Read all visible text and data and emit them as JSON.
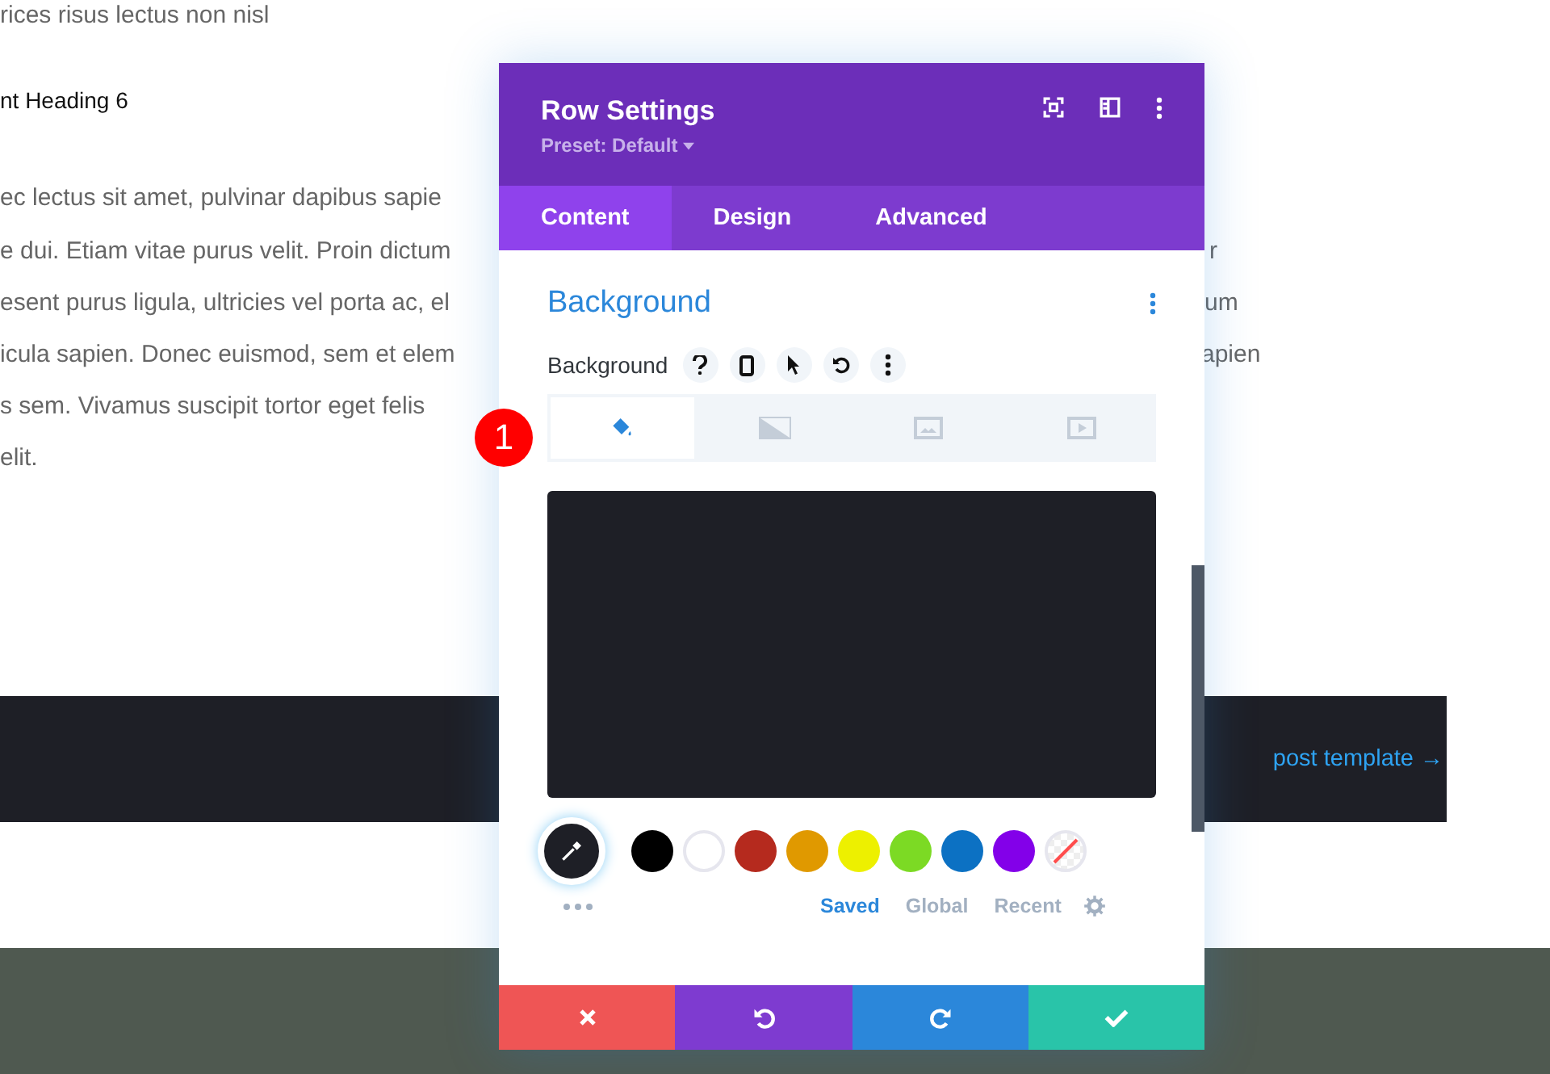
{
  "page": {
    "lines": [
      {
        "kind": "body",
        "left": "rices risus lectus non nisl"
      },
      {
        "kind": "heading",
        "left": "nt Heading 6"
      },
      {
        "kind": "body",
        "left": "ec lectus sit amet, pulvinar dapibus sapie"
      },
      {
        "kind": "body",
        "left": "e dui. Etiam vitae purus velit. Proin dictum",
        "right": "r"
      },
      {
        "kind": "body",
        "left": "esent purus ligula, ultricies vel porta ac, el",
        "right": "um"
      },
      {
        "kind": "body",
        "left": "icula sapien. Donec euismod, sem et elem",
        "right": "apien"
      },
      {
        "kind": "body",
        "left": "s sem. Vivamus suscipit tortor eget felis"
      },
      {
        "kind": "body",
        "left": "elit."
      }
    ],
    "band_link": "post template →"
  },
  "badge": "1",
  "modal": {
    "title": "Row Settings",
    "preset": "Preset: Default",
    "tabs": [
      {
        "label": "Content",
        "selected": true
      },
      {
        "label": "Design",
        "selected": false
      },
      {
        "label": "Advanced",
        "selected": false
      }
    ],
    "section": "Background",
    "field_label": "Background",
    "bg_types": [
      {
        "kind": "color",
        "selected": true
      },
      {
        "kind": "gradient",
        "selected": false
      },
      {
        "kind": "image",
        "selected": false
      },
      {
        "kind": "video",
        "selected": false
      }
    ],
    "swatches": [
      {
        "kind": "solid",
        "color": "#000000"
      },
      {
        "kind": "solid",
        "color": "#ffffff"
      },
      {
        "kind": "solid",
        "color": "#b52a1e"
      },
      {
        "kind": "solid",
        "color": "#e09900"
      },
      {
        "kind": "solid",
        "color": "#edf000"
      },
      {
        "kind": "solid",
        "color": "#7cda24"
      },
      {
        "kind": "solid",
        "color": "#0c71c3"
      },
      {
        "kind": "solid",
        "color": "#8300e9"
      },
      {
        "kind": "none"
      }
    ],
    "palette_tabs": [
      {
        "label": "Saved",
        "selected": true
      },
      {
        "label": "Global",
        "selected": false
      },
      {
        "label": "Recent",
        "selected": false
      }
    ],
    "actions": [
      {
        "kind": "cancel"
      },
      {
        "kind": "undo"
      },
      {
        "kind": "redo"
      },
      {
        "kind": "save"
      }
    ]
  }
}
